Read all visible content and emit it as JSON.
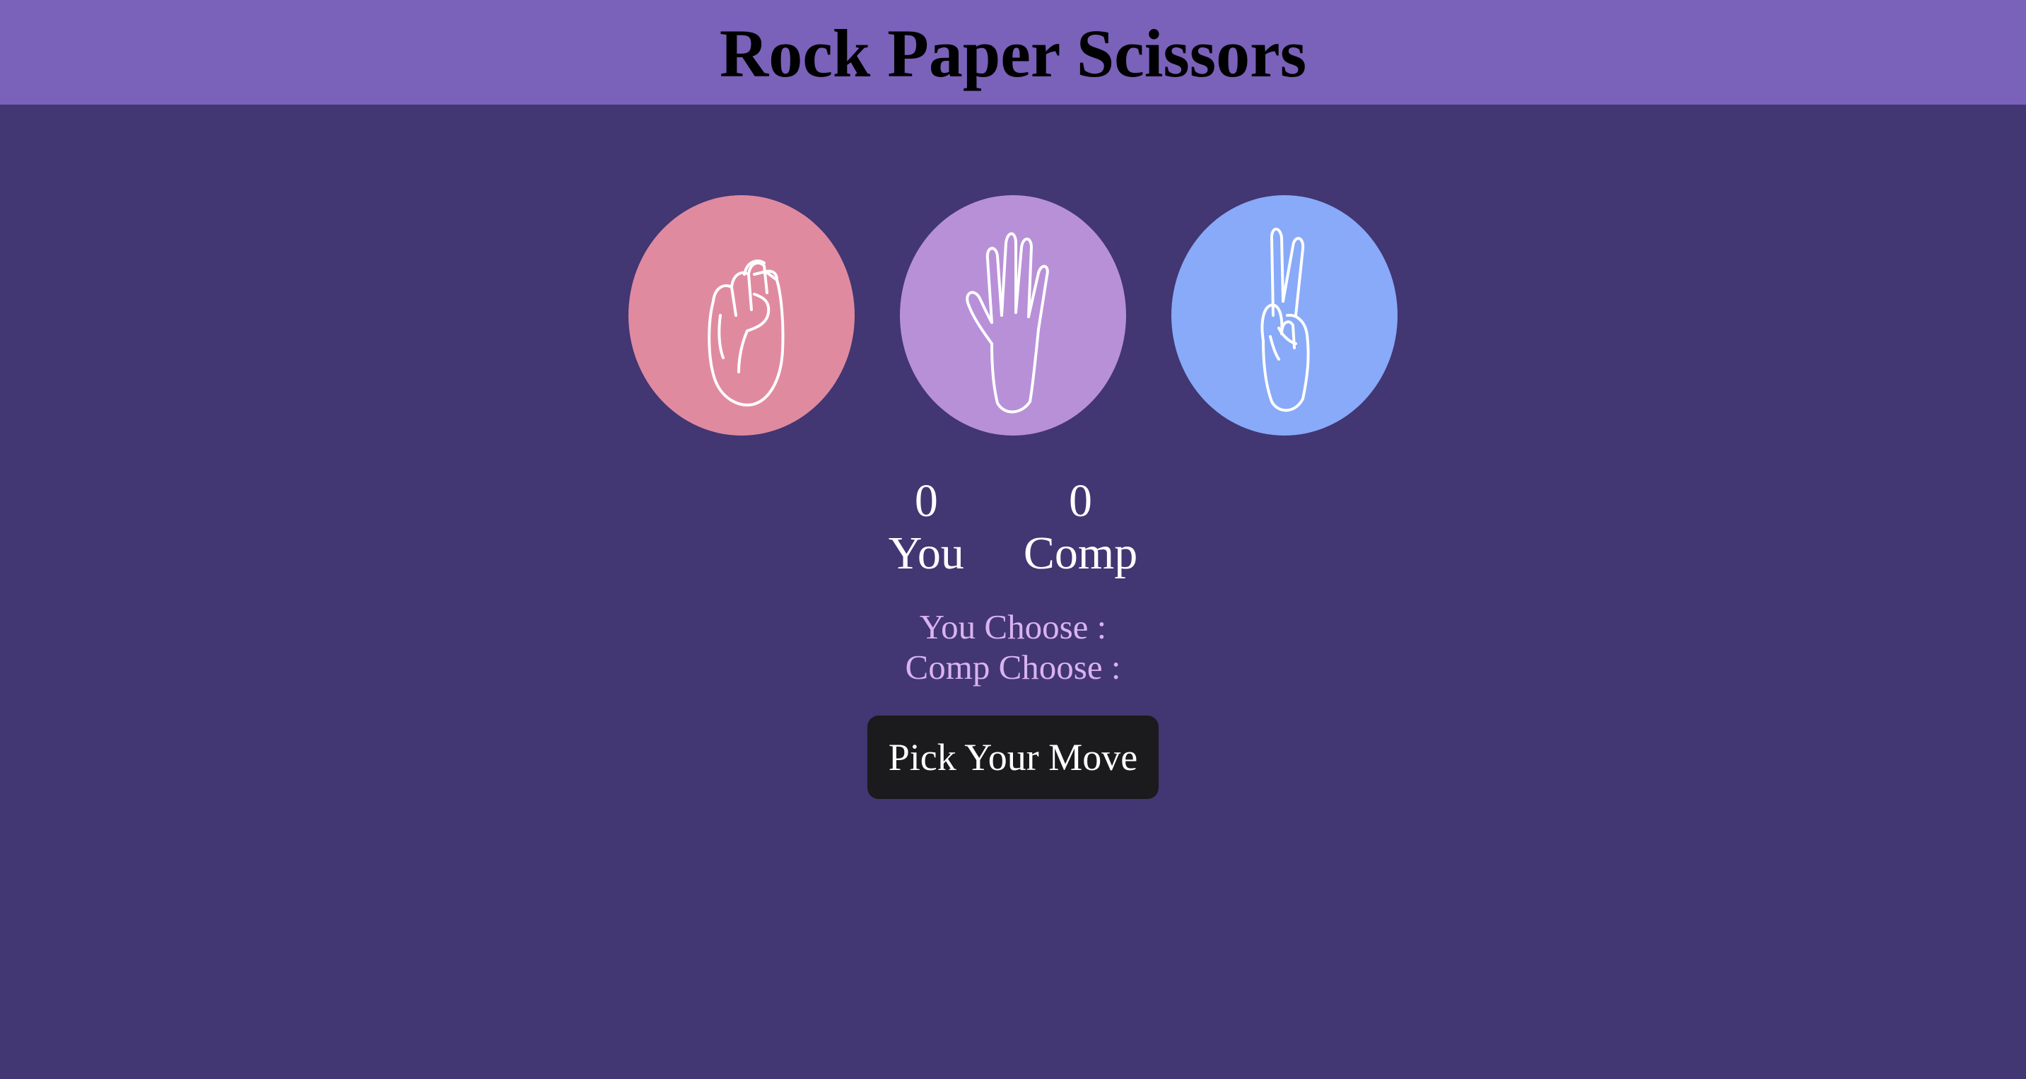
{
  "header": {
    "title": "Rock Paper Scissors",
    "background": "#7a61ba"
  },
  "page": {
    "background": "#423673"
  },
  "choices": [
    {
      "id": "rock",
      "icon": "rock-fist-icon",
      "color": "#e08aa0"
    },
    {
      "id": "paper",
      "icon": "paper-open-hand-icon",
      "color": "#b890d8"
    },
    {
      "id": "scissors",
      "icon": "scissors-peace-hand-icon",
      "color": "#88aaf8"
    }
  ],
  "scoreboard": {
    "user": {
      "score": "0",
      "label": "You"
    },
    "comp": {
      "score": "0",
      "label": "Comp"
    }
  },
  "status": {
    "user_choice": "You Choose :",
    "comp_choice": "Comp Choose :",
    "color": "#d9b3f0"
  },
  "action": {
    "label": "Pick Your Move"
  }
}
